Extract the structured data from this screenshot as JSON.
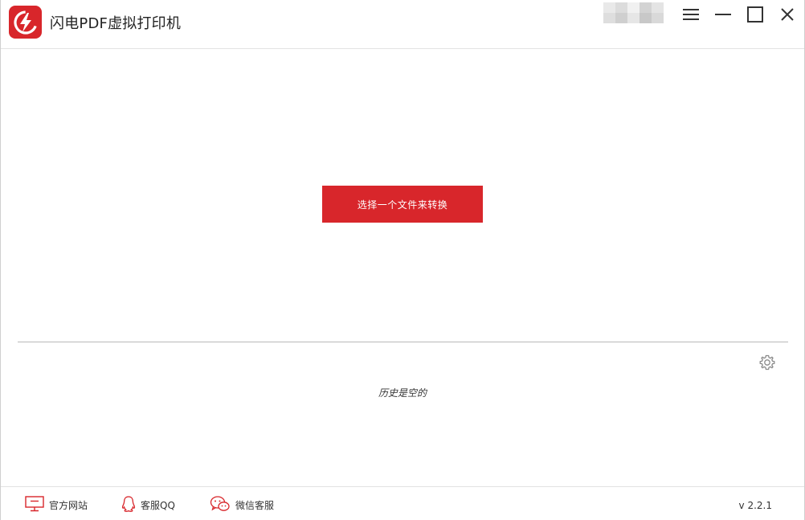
{
  "app": {
    "title": "闪电PDF虚拟打印机",
    "logo_icon": "lightning-logo",
    "accent_color": "#d8262b"
  },
  "window_controls": {
    "menu_icon": "hamburger-menu-icon",
    "minimize_icon": "minimize-icon",
    "maximize_icon": "maximize-icon",
    "close_icon": "close-icon"
  },
  "main": {
    "select_file_label": "选择一个文件来转换",
    "history_empty_text": "历史是空的",
    "settings_icon": "gear-icon"
  },
  "footer": {
    "links": [
      {
        "label": "官方网站",
        "icon": "monitor-icon"
      },
      {
        "label": "客服QQ",
        "icon": "qq-penguin-icon"
      },
      {
        "label": "微信客服",
        "icon": "wechat-icon"
      }
    ],
    "version": "v 2.2.1"
  }
}
